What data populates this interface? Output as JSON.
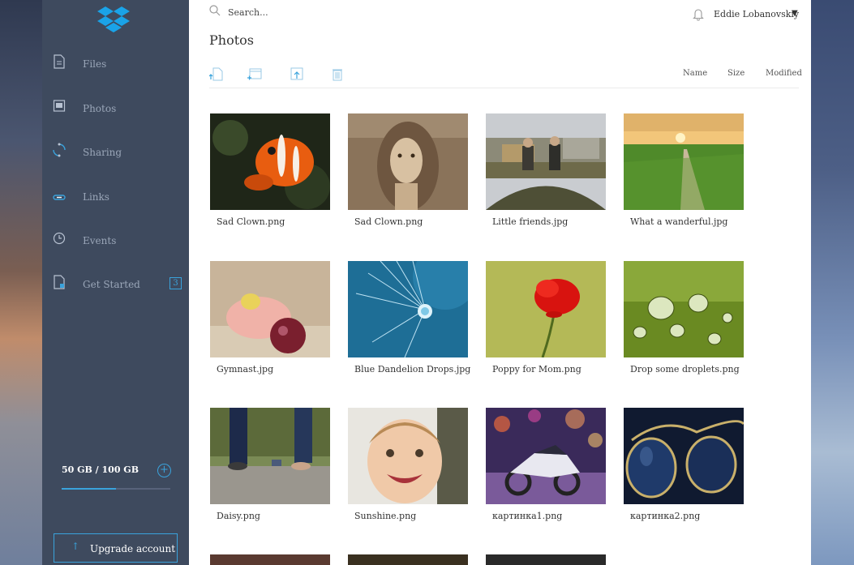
{
  "sidebar": {
    "logo": "dropbox-logo",
    "items": [
      {
        "label": "Files",
        "icon": "file-icon"
      },
      {
        "label": "Photos",
        "icon": "photo-icon"
      },
      {
        "label": "Sharing",
        "icon": "sharing-icon"
      },
      {
        "label": "Links",
        "icon": "link-icon"
      },
      {
        "label": "Events",
        "icon": "clock-icon"
      },
      {
        "label": "Get Started",
        "icon": "getstarted-icon",
        "badge": "3"
      }
    ],
    "storage": {
      "text": "50 GB / 100 GB",
      "used_fraction": 0.5
    },
    "upgrade_label": "Upgrade account"
  },
  "header": {
    "search_placeholder": "Search...",
    "user_name": "Eddie Lobanovskiy"
  },
  "main": {
    "title": "Photos",
    "toolbar": [
      "upload-file-icon",
      "new-folder-icon",
      "upload-icon",
      "delete-icon"
    ],
    "sort_labels": [
      "Name",
      "Size",
      "Modified"
    ],
    "photos": [
      "Sad Clown.png",
      "Sad Clown.png",
      "Little friends.jpg",
      "What a wanderful.jpg",
      "Gymnast.jpg",
      "Blue Dandelion Drops.jpg",
      "Poppy for Mom.png",
      "Drop some droplets.png",
      "Daisy.png",
      "Sunshine.png",
      "картинка1.png",
      "картинка2.png"
    ]
  },
  "colors": {
    "accent": "#3aa3dc",
    "sidebar": "#3e4a5e"
  }
}
